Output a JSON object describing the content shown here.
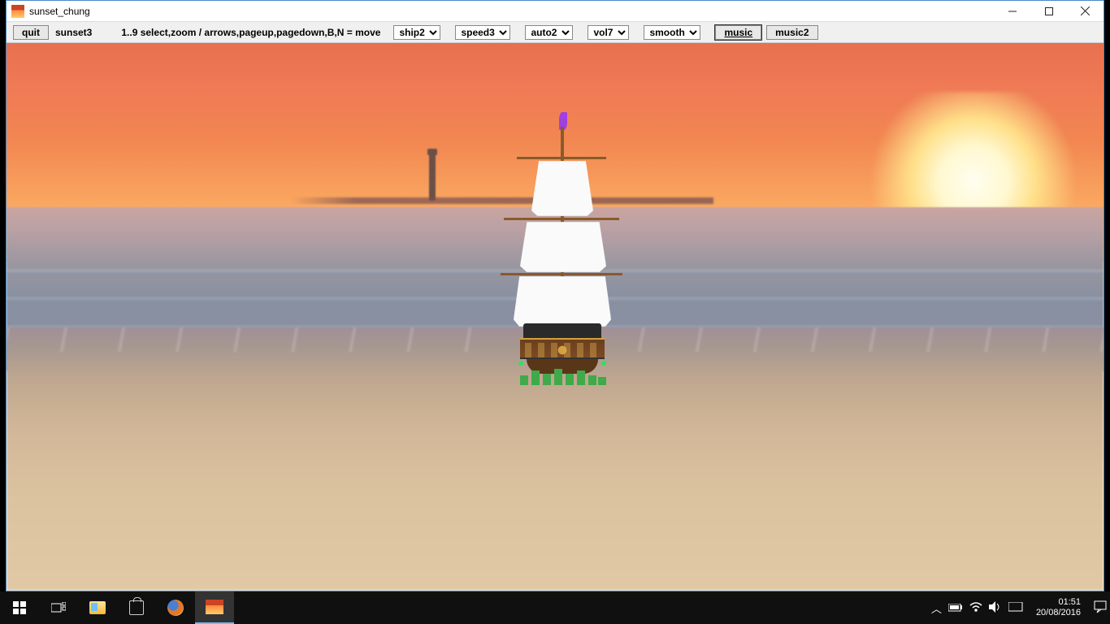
{
  "window": {
    "title": "sunset_chung"
  },
  "toolbar": {
    "quit": "quit",
    "scene": "sunset3",
    "hint": "1..9 select,zoom / arrows,pageup,pagedown,B,N = move",
    "ship": "ship2",
    "speed": "speed3",
    "auto": "auto2",
    "vol": "vol7",
    "smooth": "smooth",
    "music": "music",
    "music2": "music2"
  },
  "taskbar": {
    "time": "01:51",
    "date": "20/08/2016"
  }
}
